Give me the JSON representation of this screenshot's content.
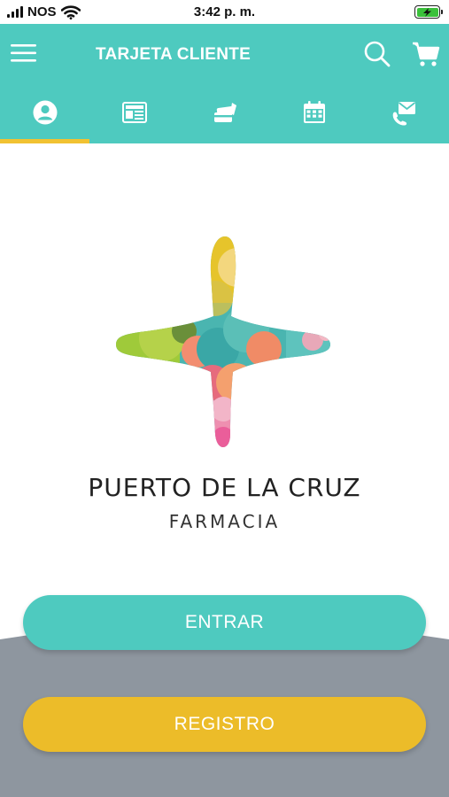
{
  "status_bar": {
    "carrier": "NOS",
    "time": "3:42 p. m."
  },
  "header": {
    "title": "TARJETA CLIENTE"
  },
  "tabs": [
    {
      "icon": "user-icon",
      "active": true
    },
    {
      "icon": "news-icon",
      "active": false
    },
    {
      "icon": "cards-icon",
      "active": false
    },
    {
      "icon": "calendar-icon",
      "active": false
    },
    {
      "icon": "contact-icon",
      "active": false
    }
  ],
  "brand": {
    "name": "PUERTO DE LA CRUZ",
    "subtitle": "FARMACIA"
  },
  "actions": {
    "enter_label": "ENTRAR",
    "register_label": "REGISTRO"
  },
  "colors": {
    "primary": "#4ecabf",
    "accent": "#ecbc29",
    "indicator": "#f1c232",
    "background_curve": "#8e969f"
  }
}
